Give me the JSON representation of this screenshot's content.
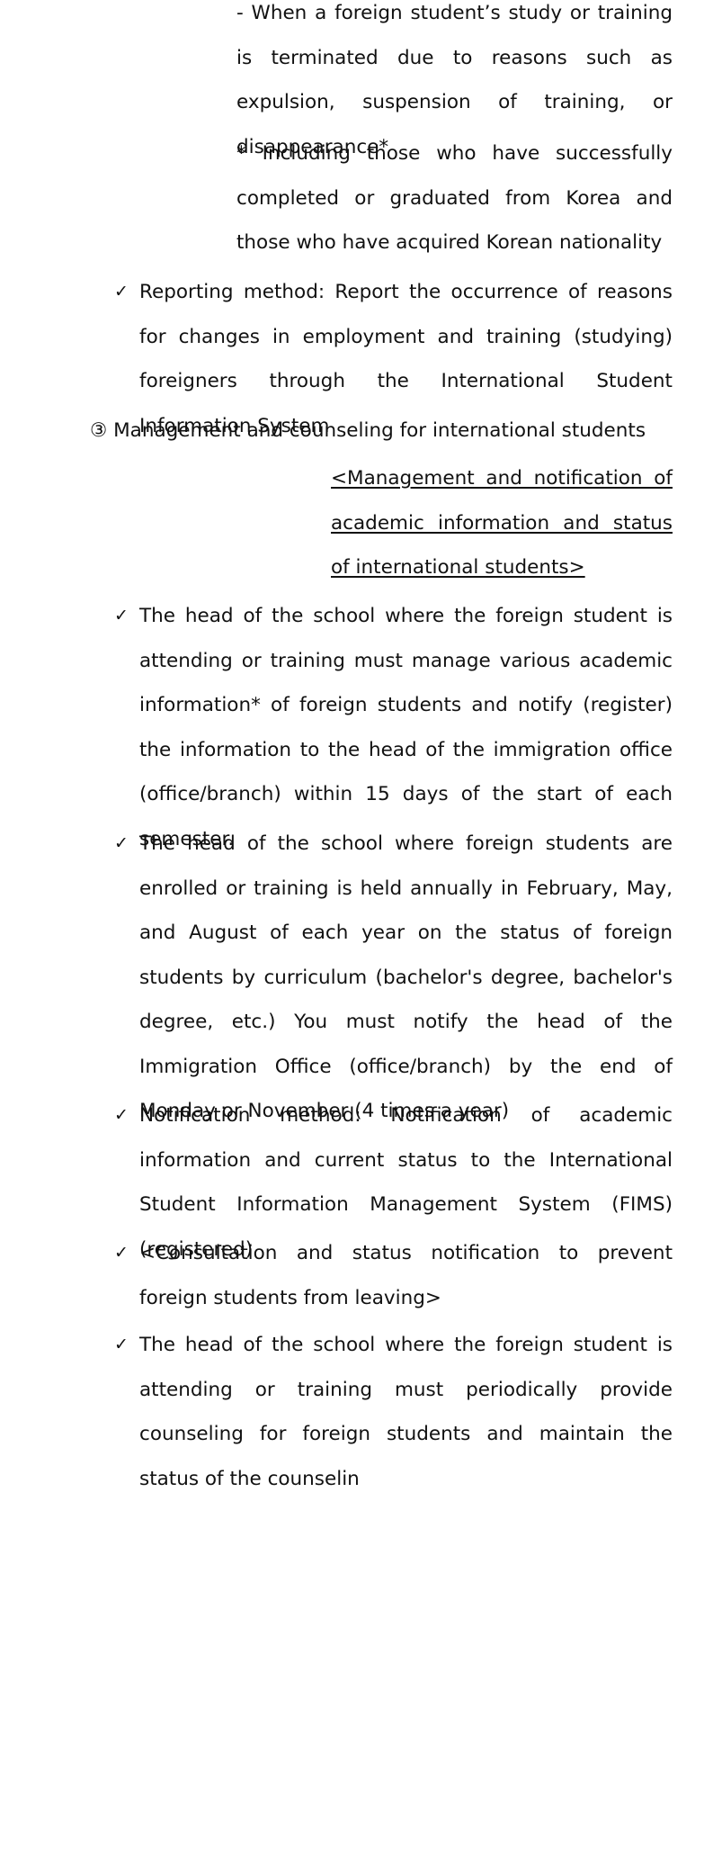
{
  "blocks": {
    "termination_reason": "- When a foreign student’s study or training is terminated due to reasons such as expulsion, suspension of training, or disappearance*",
    "termination_footnote": "* Including those who have successfully completed or graduated from Korea and those who have acquired Korean nationality",
    "reporting_method": "Reporting method: Report the occurrence of reasons for changes in employment and training (studying) foreigners through the International Student Information System",
    "section_heading": "③ Management and counseling for international students",
    "subsection_title": "<Management and notification of academic information and status of international students>",
    "academic_info": "The head of the school where the foreign student is attending or training must manage various academic information* of foreign students and notify (register) the information to the head of the immigration office (office/branch) within 15 days of the start of each semester.",
    "status_notification": "The head of the school where foreign students are enrolled or training is held annually in February, May, and August of each year on the status of foreign students by curriculum (bachelor's degree, bachelor's degree, etc.) You must notify the head of the Immigration Office (office/branch) by the end of Monday or November (4 times a year)",
    "notification_method": "Notification method: Notification of academic information and current status to the International Student Information Management System (FIMS) (registered)",
    "consultation_title": "<Consultation and status notification to prevent foreign students from leaving>",
    "counseling": "The head of the school where the foreign student is attending or training must periodically provide counseling for foreign students and maintain the status of the counselin"
  },
  "check_symbol": "✓"
}
